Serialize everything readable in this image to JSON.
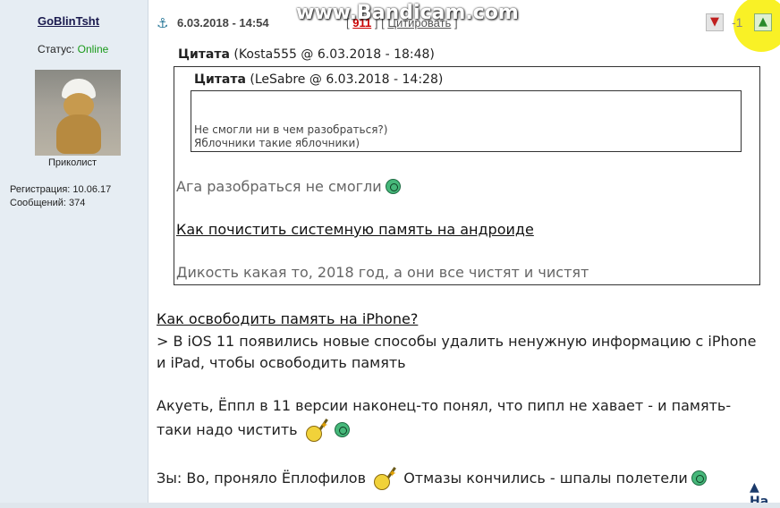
{
  "watermark": "www.Bandicam.com",
  "user": {
    "name": "GoBlinTsht",
    "status_label": "Статус:",
    "status_value": "Online",
    "rank": "Приколист",
    "registration": "Регистрация: 10.06.17",
    "messages": "Сообщений: 374"
  },
  "post": {
    "date": "6.03.2018 - 14:54",
    "number_prefix": "[",
    "number": "911",
    "number_suffix": "] [",
    "quote_link": "Цитировать",
    "quote_suffix": "]",
    "rating": "-1",
    "dislike_icon": "thumbs-down-icon",
    "like_icon": "thumbs-up-icon"
  },
  "outer_quote": {
    "label": "Цитата",
    "meta": " (Kosta555 @ 6.03.2018 - 18:48)",
    "line1": "Ага разобраться не смогли",
    "link": "Как почистить системную память на андроиде ",
    "line3": "Дикость какая то, 2018 год, а они все чистят и чистят"
  },
  "inner_quote": {
    "label": "Цитата",
    "meta": " (LeSabre @ 6.03.2018 - 14:28)",
    "line1": "Не смогли ни в чем разобраться?)",
    "line2": "Яблочники такие яблочники)"
  },
  "body": {
    "link": "Как освободить память на iPhone?",
    "para1": "> В iOS 11 появились новые способы удалить ненужную информацию с iPhone и iPad, чтобы освободить память",
    "para2": "Акуеть, Ёппл в 11 версии наконец-то понял, что пипл не хавает - и память-таки надо чистить",
    "para3a": "Зы: Во, проняло Ёплофилов",
    "para3b": "Отмазы кончились - шпалы полетели"
  },
  "nav": {
    "next_label": "На"
  },
  "colors": {
    "sidebar_bg": "#e6edf3",
    "online": "#1a9a1a",
    "post_number": "#cc0000",
    "highlight": "#f8ee00"
  }
}
